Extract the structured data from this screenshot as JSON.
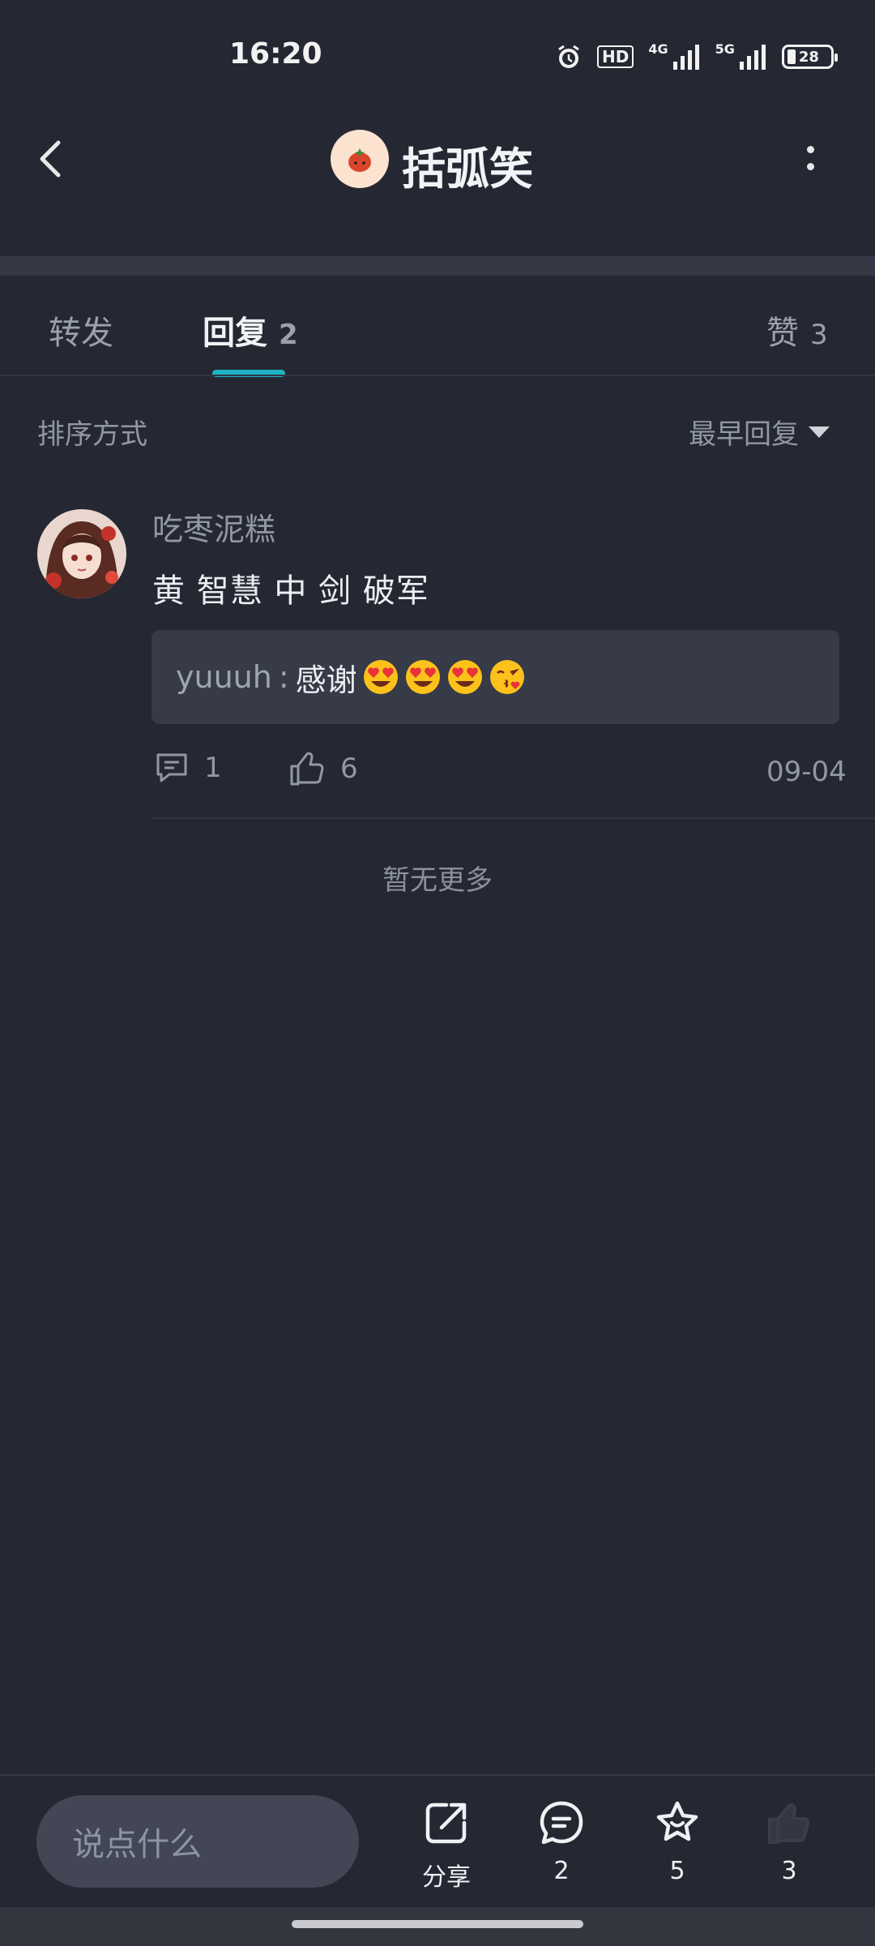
{
  "status_bar": {
    "time": "16:20",
    "hd_label": "HD",
    "net1": "4G",
    "net2": "5G",
    "battery": "28"
  },
  "header": {
    "title": "括弧笑",
    "avatar_icon": "tomato-icon"
  },
  "tabs": {
    "forward_label": "转发",
    "reply_label": "回复",
    "reply_count": "2",
    "like_label": "赞",
    "like_count": "3",
    "active_color": "#1fb3c4"
  },
  "sort": {
    "label": "排序方式",
    "selected": "最早回复"
  },
  "comment": {
    "username": "吃枣泥糕",
    "text": "黄 智慧 中 剑 破军",
    "quote_user": "yuuuh",
    "quote_sep": ":",
    "quote_text": "感谢",
    "quote_emojis": [
      "heart-eyes",
      "heart-eyes",
      "heart-eyes",
      "kissing-heart"
    ],
    "reply_count": "1",
    "like_count": "6",
    "date": "09-04"
  },
  "no_more": "暂无更多",
  "bottom_bar": {
    "input_placeholder": "说点什么",
    "share_label": "分享",
    "comments_count": "2",
    "favorites_count": "5",
    "likes_count": "3"
  }
}
